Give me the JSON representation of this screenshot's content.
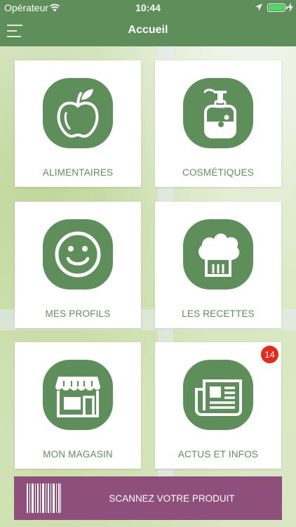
{
  "status_bar": {
    "carrier": "Opérateur",
    "time": "10:44"
  },
  "nav": {
    "title": "Accueil"
  },
  "tiles": [
    {
      "label": "ALIMENTAIRES",
      "icon": "apple-icon"
    },
    {
      "label": "COSMÉTIQUES",
      "icon": "soap-dispenser-icon"
    },
    {
      "label": "MES PROFILS",
      "icon": "smiley-icon"
    },
    {
      "label": "LES RECETTES",
      "icon": "chef-hat-icon"
    },
    {
      "label": "MON MAGASIN",
      "icon": "shop-icon"
    },
    {
      "label": "ACTUS ET INFOS",
      "icon": "newspaper-icon",
      "badge": "14"
    }
  ],
  "scan": {
    "label": "SCANNEZ VOTRE PRODUIT",
    "icon": "barcode-icon"
  },
  "colors": {
    "brand_green": "#5e8f5a",
    "scan_purple": "#8e4f7c",
    "badge_red": "#e8291c"
  }
}
